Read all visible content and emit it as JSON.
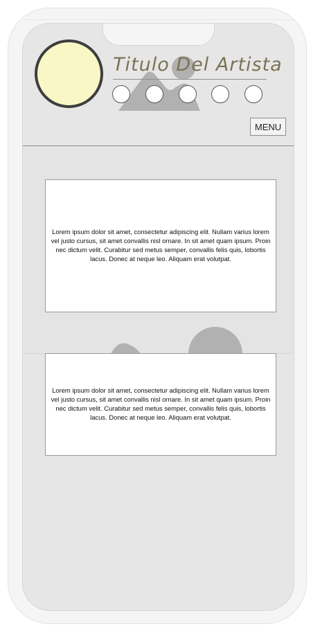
{
  "header": {
    "title": "Titulo Del Artista",
    "menu_label": "MENU",
    "social_links": [
      "",
      "",
      "",
      "",
      ""
    ]
  },
  "cards": [
    {
      "text": "Lorem ipsum dolor sit amet, consectetur adipiscing elit. Nullam varius lorem vel justo cursus, sit amet convallis nisl ornare. In sit amet quam ipsum. Proin nec dictum velit. Curabitur sed metus semper, convallis felis quis, lobortis lacus. Donec at neque leo. Aliquam erat volutpat."
    },
    {
      "text": "Lorem ipsum dolor sit amet, consectetur adipiscing elit. Nullam varius lorem vel justo cursus, sit amet convallis nisl ornare. In sit amet quam ipsum. Proin nec dictum velit. Curabitur sed metus semper, convallis felis quis, lobortis lacus. Donec at neque leo. Aliquam erat volutpat."
    }
  ],
  "colors": {
    "avatar_fill": "#faf7c6",
    "avatar_border": "#3e3e3e",
    "title_color": "#7a7355",
    "screen_bg": "#e6e6e6",
    "placeholder_shape": "#b1b1b1"
  },
  "icons": {
    "avatar": "avatar-circle",
    "header_image": "image-placeholder-icon",
    "hero_image": "image-placeholder-icon"
  }
}
